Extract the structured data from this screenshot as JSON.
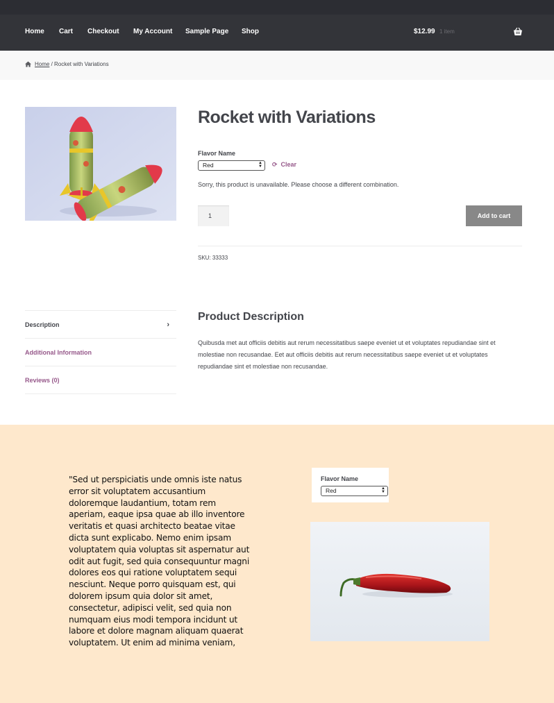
{
  "nav": {
    "items": [
      {
        "label": "Home"
      },
      {
        "label": "Cart"
      },
      {
        "label": "Checkout"
      },
      {
        "label": "My Account"
      },
      {
        "label": "Sample Page"
      },
      {
        "label": "Shop"
      }
    ],
    "cart_total": "$12.99",
    "cart_count": "1 item",
    "cart_icon": "basket-icon"
  },
  "breadcrumb": {
    "home_label": "Home",
    "separator": " / ",
    "current": "Rocket with Variations",
    "icon": "home-icon"
  },
  "product": {
    "image": "rocket-toy-image",
    "title": "Rocket with Variations",
    "attribute_label": "Flavor Name",
    "attribute_value": "Red",
    "clear_label": "Clear",
    "clear_icon": "refresh-icon",
    "unavailable_message": "Sorry, this product is unavailable. Please choose a different combination.",
    "quantity": "1",
    "add_to_cart_label": "Add to cart",
    "sku_label": "SKU:",
    "sku_value": "33333",
    "button_color": "#888888",
    "accent_color": "#96588a"
  },
  "tabs": [
    {
      "label": "Description",
      "active": true
    },
    {
      "label": "Additional Information",
      "active": false
    },
    {
      "label": "Reviews (0)",
      "active": false
    }
  ],
  "description": {
    "heading": "Product Description",
    "body": "Quibusda met aut officiis debitis aut rerum necessitatibus saepe eveniet ut et voluptates repudiandae sint et molestiae non recusandae. Eet aut officiis debitis aut rerum necessitatibus saepe eveniet ut et voluptates repudiandae sint et molestiae non recusandae."
  },
  "promo": {
    "background": "#fee8cc",
    "quote": "\"Sed ut perspiciatis unde omnis iste natus error sit voluptatem accusantium doloremque laudantium, totam rem aperiam, eaque ipsa quae ab illo inventore veritatis et quasi architecto beatae vitae dicta sunt explicabo. Nemo enim ipsam voluptatem quia voluptas sit aspernatur aut odit aut fugit, sed quia consequuntur magni dolores eos qui ratione voluptatem sequi nesciunt. Neque porro quisquam est, qui dolorem ipsum quia dolor sit amet, consectetur, adipisci velit, sed quia non numquam eius modi tempora incidunt ut labore et dolore magnam aliquam quaerat voluptatem. Ut enim ad minima veniam,",
    "attribute_label": "Flavor Name",
    "attribute_value": "Red",
    "image": "red-chili-pepper-image"
  }
}
